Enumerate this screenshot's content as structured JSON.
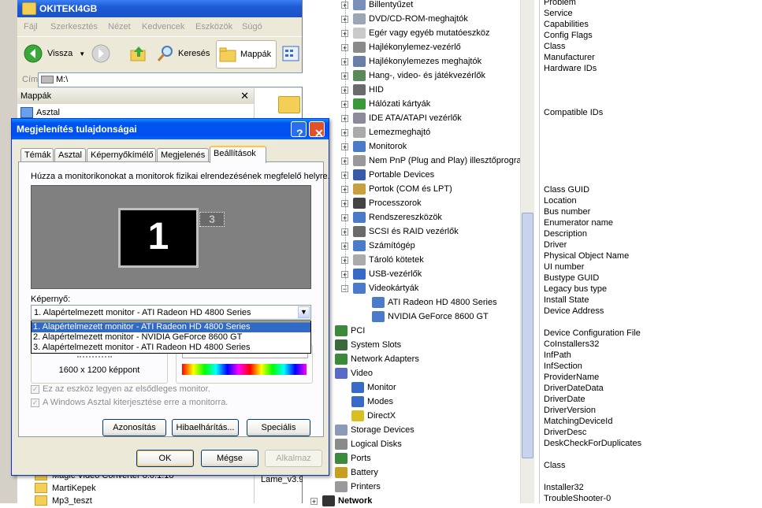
{
  "explorer": {
    "title": "OKITEKI4GB",
    "menu": [
      "Fájl",
      "Szerkesztés",
      "Nézet",
      "Kedvencek",
      "Eszközök",
      "Súgó"
    ],
    "toolbar": {
      "back": "Vissza",
      "search": "Keresés",
      "folders": "Mappák"
    },
    "address_label": "Cím",
    "address_value": "M:\\",
    "folders_pane_title": "Mappák",
    "folders_top": [
      "Asztal"
    ],
    "folders_bottom": [
      "Magic Video Converter 8.0.1.18",
      "MartiKepek",
      "Mp3_teszt"
    ],
    "right_file": "Lame_v3.9"
  },
  "devtree": {
    "items": [
      {
        "label": "Billentyűzet",
        "indent": 1
      },
      {
        "label": "DVD/CD-ROM-meghajtók",
        "indent": 1
      },
      {
        "label": "Egér vagy egyéb mutatóeszköz",
        "indent": 1
      },
      {
        "label": "Hajlékonylemez-vezérlő",
        "indent": 1
      },
      {
        "label": "Hajlékonylemezes meghajtók",
        "indent": 1
      },
      {
        "label": "Hang-, video- és játékvezérlők",
        "indent": 1
      },
      {
        "label": "HID",
        "indent": 1
      },
      {
        "label": "Hálózati kártyák",
        "indent": 1
      },
      {
        "label": "IDE ATA/ATAPI vezérlők",
        "indent": 1
      },
      {
        "label": "Lemezmeghajtó",
        "indent": 1
      },
      {
        "label": "Monitorok",
        "indent": 1
      },
      {
        "label": "Nem PnP (Plug and Play) illesztőprogram",
        "indent": 1
      },
      {
        "label": "Portable Devices",
        "indent": 1
      },
      {
        "label": "Portok (COM és LPT)",
        "indent": 1
      },
      {
        "label": "Processzorok",
        "indent": 1
      },
      {
        "label": "Rendszereszközök",
        "indent": 1
      },
      {
        "label": "SCSI és RAID vezérlők",
        "indent": 1
      },
      {
        "label": "Számítógép",
        "indent": 1
      },
      {
        "label": "Tároló kötetek",
        "indent": 1
      },
      {
        "label": "USB-vezérlők",
        "indent": 1
      },
      {
        "label": "Videokártyák",
        "indent": 1,
        "expanded": true
      },
      {
        "label": "ATI Radeon HD 4800 Series",
        "indent": 2
      },
      {
        "label": "NVIDIA GeForce 8600 GT",
        "indent": 2
      },
      {
        "label": "PCI",
        "indent": 0
      },
      {
        "label": "System Slots",
        "indent": 0
      },
      {
        "label": "Network Adapters",
        "indent": 0
      },
      {
        "label": "Video",
        "indent": 0
      },
      {
        "label": "Monitor",
        "indent": 1
      },
      {
        "label": "Modes",
        "indent": 1
      },
      {
        "label": "DirectX",
        "indent": 1
      },
      {
        "label": "Storage Devices",
        "indent": 0
      },
      {
        "label": "Logical Disks",
        "indent": 0
      },
      {
        "label": "Ports",
        "indent": 0
      },
      {
        "label": "Battery",
        "indent": 0
      },
      {
        "label": "Printers",
        "indent": 0
      },
      {
        "label": "Network",
        "indent": -1
      }
    ]
  },
  "properties": {
    "items": [
      "Problem",
      "Service",
      "Capabilities",
      "Config Flags",
      "Class",
      "Manufacturer",
      "Hardware IDs",
      "",
      "",
      "",
      "Compatible IDs",
      "",
      "",
      "",
      "",
      "",
      "",
      "Class GUID",
      "Location",
      "Bus number",
      "Enumerator name",
      "Description",
      "Driver",
      "Physical Object Name",
      "UI number",
      "Bustype GUID",
      "Legacy bus type",
      "Install State",
      "Device Address",
      "",
      "Device Configuration File",
      "CoInstallers32",
      "InfPath",
      "InfSection",
      "ProviderName",
      "DriverDateData",
      "DriverDate",
      "DriverVersion",
      "MatchingDeviceId",
      "DriverDesc",
      "DeskCheckForDuplicates",
      "",
      "Class",
      "",
      "Installer32",
      "TroubleShooter-0"
    ]
  },
  "dialog": {
    "title": "Megjelenítés tulajdonságai",
    "tabs": [
      "Témák",
      "Asztal",
      "Képernyőkímélő",
      "Megjelenés",
      "Beállítások"
    ],
    "active_tab": "Beállítások",
    "instruction": "Húzza a monitorikonokat a monitorok fizikai elrendezésének megfelelő helyre.",
    "monitor_main": "1",
    "monitor_secondary": "3",
    "screen_label": "Képernyő:",
    "screen_selected": "1. Alapértelmezett monitor - ATI Radeon HD 4800 Series",
    "screen_options": [
      "1. Alapértelmezett monitor - ATI Radeon HD 4800 Series",
      "2. Alapértelmezett monitor - NVIDIA GeForce 8600 GT",
      "3. Alapértelmezett monitor - ATI Radeon HD 4800 Series"
    ],
    "resolution": "1600 x 1200 képpont",
    "chk_primary": "Ez az eszköz legyen az elsődleges monitor.",
    "chk_extend": "A Windows Asztal kiterjesztése erre a monitorra.",
    "btn_identify": "Azonosítás",
    "btn_troubleshoot": "Hibaelhárítás...",
    "btn_advanced": "Speciális",
    "btn_ok": "OK",
    "btn_cancel": "Mégse",
    "btn_apply": "Alkalmaz",
    "help_glyph": "?",
    "close_glyph": "✕"
  },
  "colors": {
    "title_blue": "#0053EE",
    "selection": "#316AC5"
  }
}
